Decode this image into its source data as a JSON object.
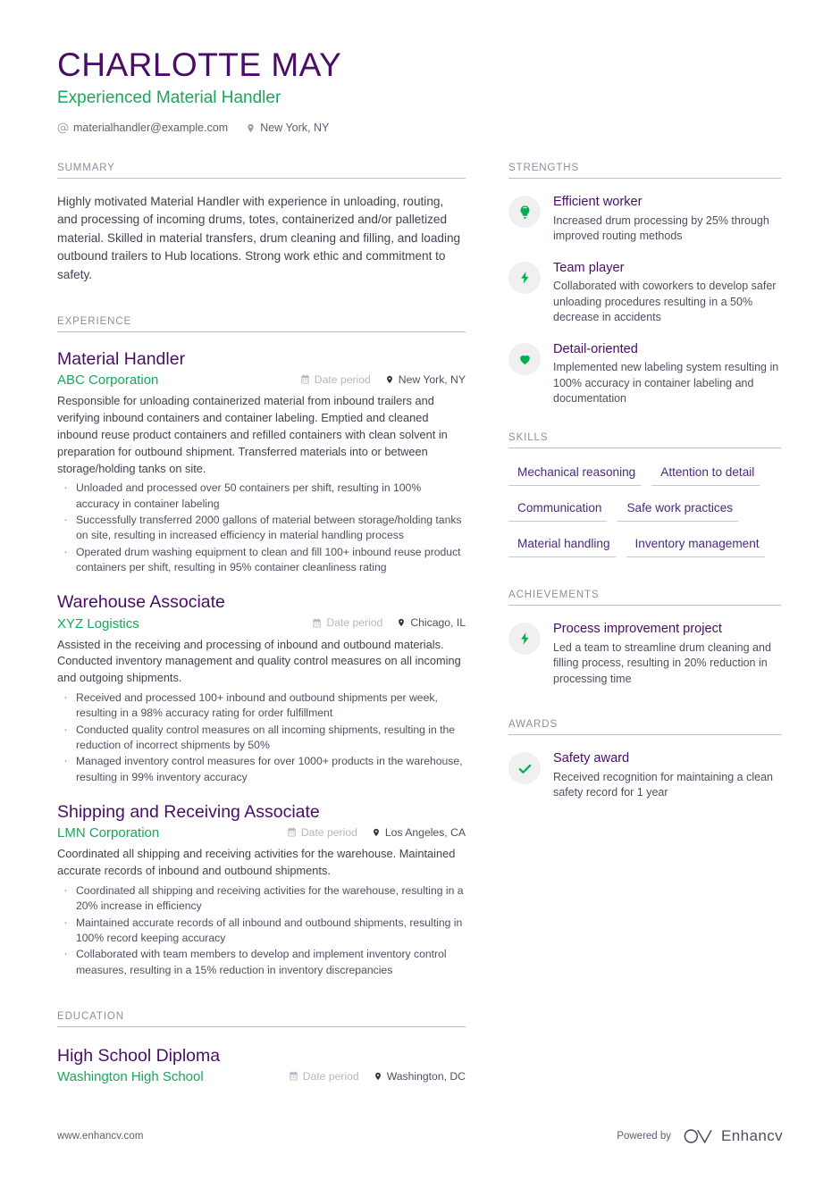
{
  "colors": {
    "heading_purple": "#4a0d66",
    "accent_green": "#1aa65b",
    "section_label": "#8a909c",
    "body_text": "#3f4451",
    "skill_purple": "#4a2a7a",
    "muted": "#b3b8c2"
  },
  "header": {
    "name": "CHARLOTTE MAY",
    "role": "Experienced Material Handler",
    "email": "materialhandler@example.com",
    "location": "New York, NY",
    "email_icon": "at-sign-icon",
    "location_icon": "map-pin-icon"
  },
  "sections": {
    "summary_label": "SUMMARY",
    "experience_label": "EXPERIENCE",
    "education_label": "EDUCATION",
    "strengths_label": "STRENGTHS",
    "skills_label": "SKILLS",
    "achievements_label": "ACHIEVEMENTS",
    "awards_label": "AWARDS"
  },
  "summary": {
    "text": "Highly motivated Material Handler with experience in unloading, routing, and processing of incoming drums, totes, containerized and/or palletized material. Skilled in material transfers, drum cleaning and filling, and loading outbound trailers to Hub locations. Strong work ethic and commitment to safety."
  },
  "experience": [
    {
      "title": "Material Handler",
      "company": "ABC Corporation",
      "date": "Date period",
      "location": "New York, NY",
      "description": "Responsible for unloading containerized material from inbound trailers and verifying inbound containers and container labeling. Emptied and cleaned inbound reuse product containers and refilled containers with clean solvent in preparation for outbound shipment. Transferred materials into or between storage/holding tanks on site.",
      "bullets": [
        "Unloaded and processed over 50 containers per shift, resulting in 100% accuracy in container labeling",
        "Successfully transferred 2000 gallons of material between storage/holding tanks on site, resulting in increased efficiency in material handling process",
        "Operated drum washing equipment to clean and fill 100+ inbound reuse product containers per shift, resulting in 95% container cleanliness rating"
      ]
    },
    {
      "title": "Warehouse Associate",
      "company": "XYZ Logistics",
      "date": "Date period",
      "location": "Chicago, IL",
      "description": "Assisted in the receiving and processing of inbound and outbound materials. Conducted inventory management and quality control measures on all incoming and outgoing shipments.",
      "bullets": [
        "Received and processed 100+ inbound and outbound shipments per week, resulting in a 98% accuracy rating for order fulfillment",
        "Conducted quality control measures on all incoming shipments, resulting in the reduction of incorrect shipments by 50%",
        "Managed inventory control measures for over 1000+ products in the warehouse, resulting in 99% inventory accuracy"
      ]
    },
    {
      "title": "Shipping and Receiving Associate",
      "company": "LMN Corporation",
      "date": "Date period",
      "location": "Los Angeles, CA",
      "description": "Coordinated all shipping and receiving activities for the warehouse. Maintained accurate records of inbound and outbound shipments.",
      "bullets": [
        "Coordinated all shipping and receiving activities for the warehouse, resulting in a 20% increase in efficiency",
        "Maintained accurate records of all inbound and outbound shipments, resulting in 100% record keeping accuracy",
        "Collaborated with team members to develop and implement inventory control measures, resulting in a 15% reduction in inventory discrepancies"
      ]
    }
  ],
  "education": [
    {
      "degree": "High School Diploma",
      "school": "Washington High School",
      "date": "Date period",
      "location": "Washington, DC"
    }
  ],
  "strengths": [
    {
      "icon": "lightbulb-icon",
      "title": "Efficient worker",
      "desc": "Increased drum processing by 25% through improved routing methods"
    },
    {
      "icon": "lightning-bolt-icon",
      "title": "Team player",
      "desc": "Collaborated with coworkers to develop safer unloading procedures resulting in a 50% decrease in accidents"
    },
    {
      "icon": "heart-icon",
      "title": "Detail-oriented",
      "desc": "Implemented new labeling system resulting in 100% accuracy in container labeling and documentation"
    }
  ],
  "skills": [
    "Mechanical reasoning",
    "Attention to detail",
    "Communication",
    "Safe work practices",
    "Material handling",
    "Inventory management"
  ],
  "achievements": [
    {
      "icon": "lightning-bolt-icon",
      "title": "Process improvement project",
      "desc": "Led a team to streamline drum cleaning and filling process, resulting in 20% reduction in processing time"
    }
  ],
  "awards": [
    {
      "icon": "check-icon",
      "title": "Safety award",
      "desc": "Received recognition for maintaining a clean safety record for 1 year"
    }
  ],
  "footer": {
    "site": "www.enhancv.com",
    "powered_by": "Powered by",
    "brand": "Enhancv",
    "brand_icon": "enhancv-logo-icon"
  }
}
